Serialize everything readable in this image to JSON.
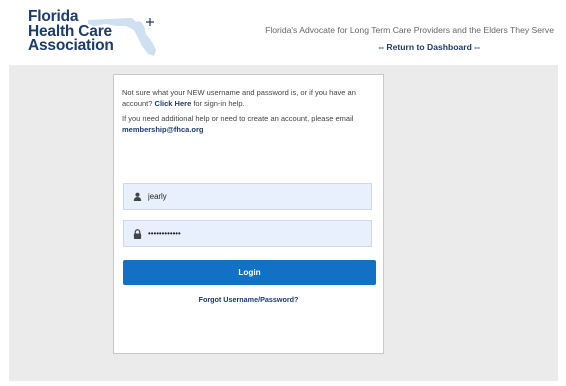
{
  "header": {
    "logo_lines": [
      "Florida",
      "Health Care",
      "Association"
    ],
    "tagline": "Florida's Advocate for Long Term Care Providers and the Elders They Serve",
    "return_link": "-- Return to Dashboard --"
  },
  "login": {
    "help_text_1_prefix": "Not sure what your NEW username and password is, or if you have an account?",
    "help_link": "Click Here",
    "help_text_1_suffix": "for sign-in help.",
    "help_text_2": "If you need additional help or need to create an account, please email",
    "help_email": "membership@fhca.org",
    "username_value": "jearly",
    "password_value": "••••••••••••",
    "login_button": "Login",
    "forgot_link": "Forgot Username/Password?"
  },
  "icons": {
    "user": "user-icon",
    "lock": "lock-icon",
    "state_map": "florida-map-icon"
  },
  "colors": {
    "brand_navy": "#1d3b6b",
    "button_blue": "#1271c4",
    "field_bg": "#e8f0fe",
    "band_bg": "#ebebeb"
  }
}
